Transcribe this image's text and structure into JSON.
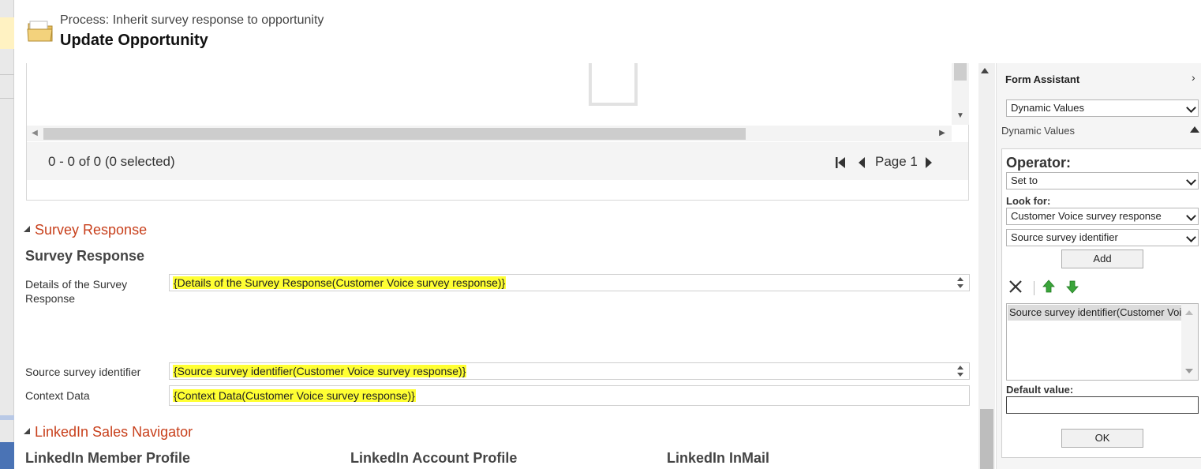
{
  "header": {
    "process_label": "Process: Inherit survey response to opportunity",
    "title": "Update Opportunity"
  },
  "grid": {
    "record_count": "0 - 0 of 0 (0 selected)",
    "page_label": "Page 1"
  },
  "survey_section": {
    "title": "Survey Response",
    "subsection_title": "Survey Response",
    "fields": [
      {
        "label": "Details of the Survey Response",
        "value": "{Details of the Survey Response(Customer Voice survey response)}"
      },
      {
        "label": "Source survey identifier",
        "value": "{Source survey identifier(Customer Voice survey response)}"
      },
      {
        "label": "Context Data",
        "value": "{Context Data(Customer Voice survey response)}"
      }
    ]
  },
  "linkedin_section": {
    "title": "LinkedIn Sales Navigator",
    "columns": [
      "LinkedIn Member Profile",
      "LinkedIn Account Profile",
      "LinkedIn InMail"
    ]
  },
  "form_assistant": {
    "title": "Form Assistant",
    "top_select": "Dynamic Values",
    "dynamic_values_label": "Dynamic Values",
    "operator_label": "Operator:",
    "operator_value": "Set to",
    "look_for_label": "Look for:",
    "look_for_entity": "Customer Voice survey response",
    "look_for_field": "Source survey identifier",
    "add_label": "Add",
    "list_items": [
      "Source survey identifier(Customer Voice survey response)"
    ],
    "default_value_label": "Default value:",
    "default_value": "",
    "ok_label": "OK"
  },
  "colors": {
    "section_title": "#c8401c",
    "highlight": "#ffff33",
    "arrow_green": "#3aa53a"
  },
  "icons": [
    "folder-icon",
    "empty-document-icon",
    "first-page-icon",
    "previous-page-icon",
    "next-page-icon",
    "delete-icon",
    "move-up-icon",
    "move-down-icon",
    "chevron-right-icon"
  ]
}
